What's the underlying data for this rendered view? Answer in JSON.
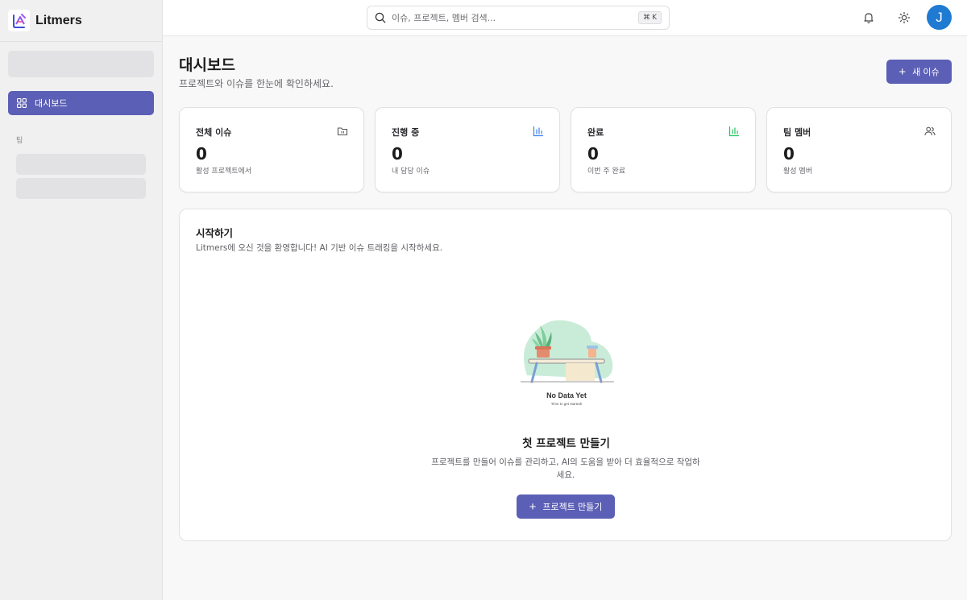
{
  "app": {
    "name": "Litmers"
  },
  "sidebar": {
    "nav": [
      {
        "label": "대시보드",
        "icon": "grid-icon",
        "active": true
      }
    ],
    "section_label": "팀"
  },
  "topbar": {
    "search_placeholder": "이슈, 프로젝트, 멤버 검색...",
    "search_shortcut": "⌘ K",
    "avatar_initial": "J"
  },
  "header": {
    "title": "대시보드",
    "subtitle": "프로젝트와 이슈를 한눈에 확인하세요.",
    "new_issue_label": "새 이슈"
  },
  "stats": [
    {
      "label": "전체 이슈",
      "value": "0",
      "note": "활성 프로젝트에서",
      "icon": "folder-icon"
    },
    {
      "label": "진행 중",
      "value": "0",
      "note": "내 담당 이슈",
      "icon": "bar-chart-icon",
      "color": "#3b82f6"
    },
    {
      "label": "완료",
      "value": "0",
      "note": "이번 주 완료",
      "icon": "bar-chart-icon",
      "color": "#22c55e"
    },
    {
      "label": "팀 멤버",
      "value": "0",
      "note": "활성 멤버",
      "icon": "users-icon"
    }
  ],
  "getting_started": {
    "title": "시작하기",
    "subtitle": "Litmers에 오신 것을 환영합니다! AI 기반 이슈 트래킹을 시작하세요.",
    "illustration": {
      "title": "No Data Yet",
      "subtitle": "Time to get started!"
    },
    "empty_title": "첫 프로젝트 만들기",
    "empty_desc": "프로젝트를 만들어 이슈를 관리하고, AI의 도움을 받아 더 효율적으로 작업하세요.",
    "create_button_label": "프로젝트 만들기"
  },
  "colors": {
    "accent": "#5b5fb5",
    "avatar": "#1f7ad2"
  }
}
